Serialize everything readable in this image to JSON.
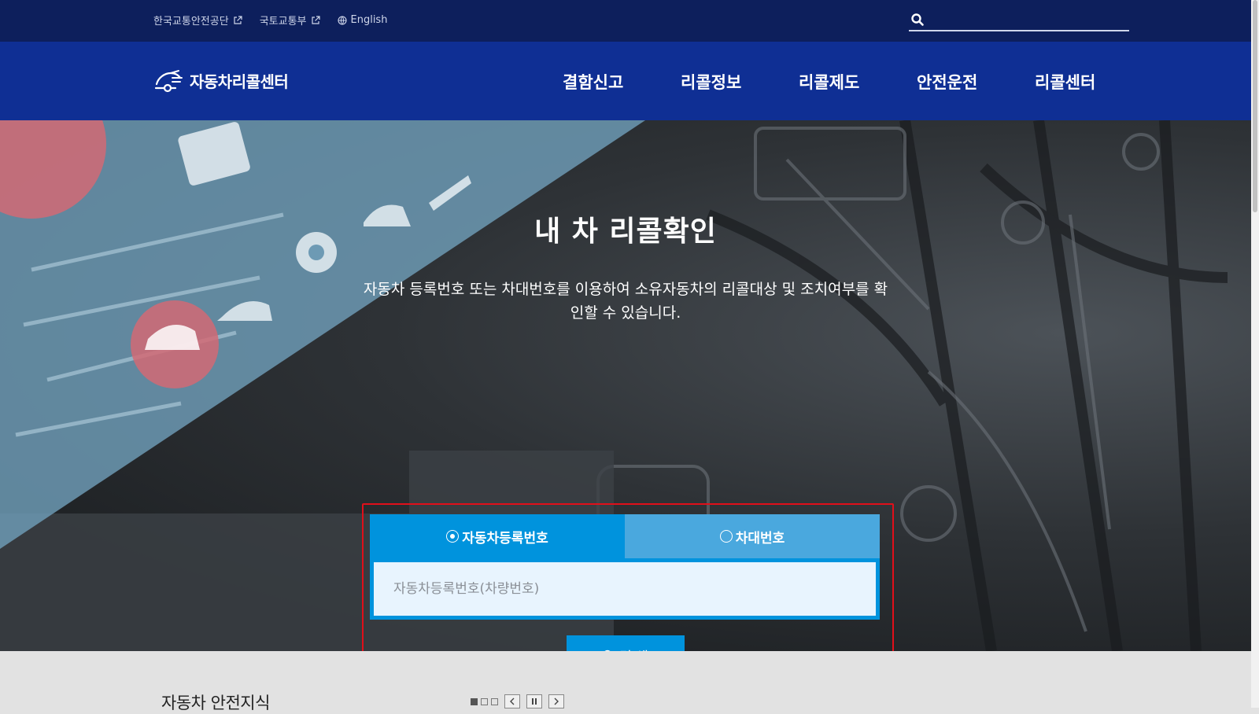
{
  "utility": {
    "links": [
      {
        "label": "한국교통안전공단",
        "icon": "external-link-icon"
      },
      {
        "label": "국토교통부",
        "icon": "external-link-icon"
      },
      {
        "label": "English",
        "icon": "globe-icon"
      }
    ],
    "search": {
      "placeholder": "",
      "value": ""
    }
  },
  "header": {
    "logo_text": "자동차리콜센터",
    "nav": [
      "결함신고",
      "리콜정보",
      "리콜제도",
      "안전운전",
      "리콜센터"
    ]
  },
  "hero": {
    "title": "내 차 리콜확인",
    "description": "자동차 등록번호 또는 차대번호를 이용하여 소유자동차의 리콜대상 및 조치여부를 확인할 수 있습니다."
  },
  "search_panel": {
    "tabs": [
      {
        "label": "자동차등록번호",
        "selected": true
      },
      {
        "label": "차대번호",
        "selected": false
      }
    ],
    "input_placeholder": "자동차등록번호(차량번호)",
    "input_value": "",
    "button_label": "검 색",
    "highlight_color": "#e10f1a"
  },
  "bottom": {
    "title": "자동차 안전지식",
    "pager": {
      "current": 1,
      "total": 3
    }
  },
  "colors": {
    "utility_bg": "#0d1f5c",
    "header_bg": "#0f2f94",
    "accent": "#0093dd"
  }
}
